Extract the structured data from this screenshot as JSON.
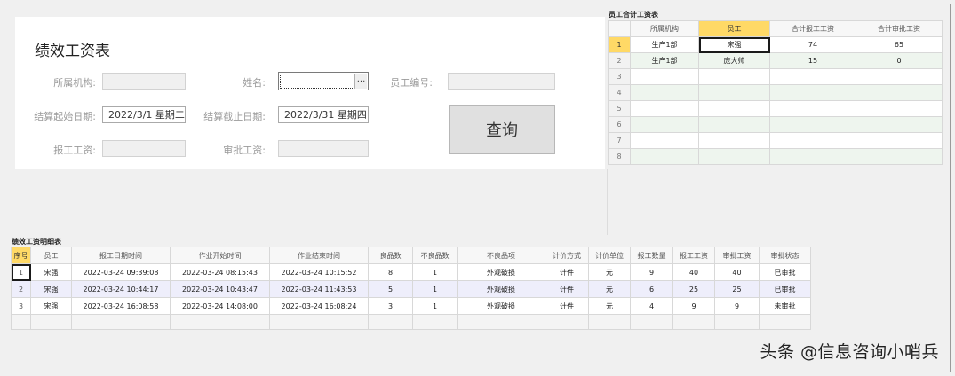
{
  "form": {
    "title": "绩效工资表",
    "org_label": "所属机构:",
    "org_value": "",
    "name_label": "姓名:",
    "name_value": "",
    "employee_no_label": "员工编号:",
    "employee_no_value": "",
    "start_date_label": "结算起始日期:",
    "start_date_value": "2022/3/1  星期二",
    "end_date_label": "结算截止日期:",
    "end_date_value": "2022/3/31  星期四",
    "report_wage_label": "报工工资:",
    "report_wage_value": "",
    "approved_wage_label": "审批工资:",
    "approved_wage_value": "",
    "query_button": "查询",
    "combo_button": "..."
  },
  "summary": {
    "caption": "员工合计工资表",
    "headers": [
      "所属机构",
      "员工",
      "合计报工工资",
      "合计审批工资"
    ],
    "row_numbers": [
      "1",
      "2",
      "3",
      "4",
      "5",
      "6",
      "7",
      "8"
    ],
    "rows": [
      [
        "生产1部",
        "宋强",
        "74",
        "65"
      ],
      [
        "生产1部",
        "庞大帅",
        "15",
        "0"
      ]
    ]
  },
  "detail": {
    "caption": "绩效工资明细表",
    "headers": [
      "序号",
      "员工",
      "报工日期时间",
      "作业开始时间",
      "作业结束时间",
      "良品数",
      "不良品数",
      "不良品项",
      "计价方式",
      "计价单位",
      "报工数量",
      "报工工资",
      "审批工资",
      "审批状态"
    ],
    "rows": [
      [
        "1",
        "宋强",
        "2022-03-24 09:39:08",
        "2022-03-24 08:15:43",
        "2022-03-24 10:15:52",
        "8",
        "1",
        "外观破损",
        "计件",
        "元",
        "9",
        "40",
        "40",
        "已审批"
      ],
      [
        "2",
        "宋强",
        "2022-03-24 10:44:17",
        "2022-03-24 10:43:47",
        "2022-03-24 11:43:53",
        "5",
        "1",
        "外观破损",
        "计件",
        "元",
        "6",
        "25",
        "25",
        "已审批"
      ],
      [
        "3",
        "宋强",
        "2022-03-24 16:08:58",
        "2022-03-24 14:08:00",
        "2022-03-24 16:08:24",
        "3",
        "1",
        "外观破损",
        "计件",
        "元",
        "4",
        "9",
        "9",
        "未审批"
      ]
    ]
  },
  "watermark": "头条 @信息咨询小哨兵",
  "colors": {
    "selected_header": "#ffd966",
    "summary_band": "#eef5ee",
    "detail_band": "#eeeefb"
  }
}
